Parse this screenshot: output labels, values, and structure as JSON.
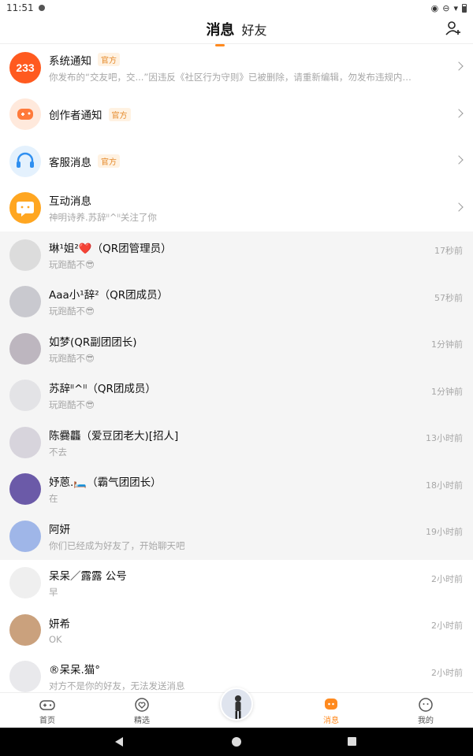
{
  "status_bar": {
    "time": "11:51"
  },
  "header": {
    "tab_active": "消息",
    "tab_other": "好友"
  },
  "notifications": [
    {
      "title": "系统通知",
      "badge": "官方",
      "sub": "你发布的“交友吧，交...”因违反《社区行为守则》已被删除，请重新编辑，勿发布违规内容哦",
      "avatar_text": "233",
      "avatar_color": "#ff5a1f",
      "icon": "233-logo-icon"
    },
    {
      "title": "创作者通知",
      "badge": "官方",
      "sub": "",
      "avatar_color": "#ffe9dc",
      "icon": "gamepad-icon"
    },
    {
      "title": "客服消息",
      "badge": "官方",
      "sub": "",
      "avatar_color": "#e4f1fd",
      "icon": "headset-icon"
    },
    {
      "title": "互动消息",
      "badge": "",
      "sub": "神明诗养.苏辞ᴵᴵ^ᴵᴵ关注了你",
      "avatar_color": "#ffa621",
      "icon": "chat-bubble-icon"
    }
  ],
  "conversations": [
    {
      "name": "琳¹姐²❤️（QR团管理员）",
      "preview": "玩跑酷不😎",
      "time": "17秒前",
      "bg": "gray",
      "avatar_color": "#dcdcdc"
    },
    {
      "name": "Aaa小¹辞²（QR团成员）",
      "preview": "玩跑酷不😎",
      "time": "57秒前",
      "bg": "gray",
      "avatar_color": "#c9c9cf"
    },
    {
      "name": "如梦(QR副团团长)",
      "preview": "玩跑酷不😎",
      "time": "1分钟前",
      "bg": "gray",
      "avatar_color": "#bdb6bf"
    },
    {
      "name": "苏辞ᴵᴵ^ᴵᴵ（QR团成员）",
      "preview": "玩跑酷不😎",
      "time": "1分钟前",
      "bg": "gray",
      "avatar_color": "#e3e3e6"
    },
    {
      "name": "陈爨龘（爱豆团老大)[招人]",
      "preview": "不去",
      "time": "13小时前",
      "bg": "gray",
      "avatar_color": "#d7d4dc"
    },
    {
      "name": "妤蒽.🛏️（霸气团团长）",
      "preview": "在",
      "time": "18小时前",
      "bg": "gray",
      "avatar_color": "#6b5aa8"
    },
    {
      "name": "阿妍",
      "preview": "你们已经成为好友了，开始聊天吧",
      "time": "19小时前",
      "bg": "gray",
      "avatar_color": "#9fb6e8"
    },
    {
      "name": "呆呆／露露 公号",
      "preview": "早",
      "time": "2小时前",
      "bg": "white",
      "avatar_color": "#efefef"
    },
    {
      "name": "妍希",
      "preview": "OK",
      "time": "2小时前",
      "bg": "white",
      "avatar_color": "#caa17d"
    },
    {
      "name": "®呆呆.猫°",
      "preview": "对方不是你的好友，无法发送消息",
      "time": "2小时前",
      "bg": "white",
      "avatar_color": "#e9e9ec"
    }
  ],
  "bottom_nav": [
    {
      "label": "首页",
      "icon": "gamepad-icon"
    },
    {
      "label": "精选",
      "icon": "heart-badge-icon"
    },
    {
      "label": "消息",
      "icon": "message-icon",
      "active": true
    },
    {
      "label": "我的",
      "icon": "smiley-icon"
    }
  ],
  "colors": {
    "accent": "#ff8a1f",
    "gray_bg": "#f5f5f5"
  }
}
